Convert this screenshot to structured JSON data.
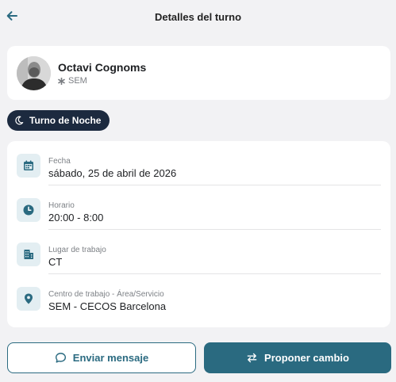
{
  "header": {
    "title": "Detalles del turno",
    "back_icon": "arrow-left-icon"
  },
  "profile": {
    "name": "Octavi Cognoms",
    "role": "SEM",
    "role_icon": "asterisk-icon"
  },
  "shift_chip": {
    "label": "Turno de Noche",
    "icon": "moon-icon"
  },
  "details": [
    {
      "icon": "calendar-icon",
      "label": "Fecha",
      "value": "sábado, 25 de abril de 2026"
    },
    {
      "icon": "clock-icon",
      "label": "Horario",
      "value": "20:00 - 8:00"
    },
    {
      "icon": "building-icon",
      "label": "Lugar de trabajo",
      "value": "CT"
    },
    {
      "icon": "location-pin-icon",
      "label": "Centro de trabajo - Área/Servicio",
      "value": "SEM - CECOS Barcelona"
    }
  ],
  "actions": {
    "message_label": "Enviar mensaje",
    "message_icon": "chat-bubble-icon",
    "propose_label": "Proponer cambio",
    "propose_icon": "swap-arrows-icon"
  },
  "colors": {
    "accent": "#2a6a80",
    "chip_bg": "#1c2a3f",
    "icon_bg": "#e3eef2",
    "background": "#f2f2f4"
  }
}
